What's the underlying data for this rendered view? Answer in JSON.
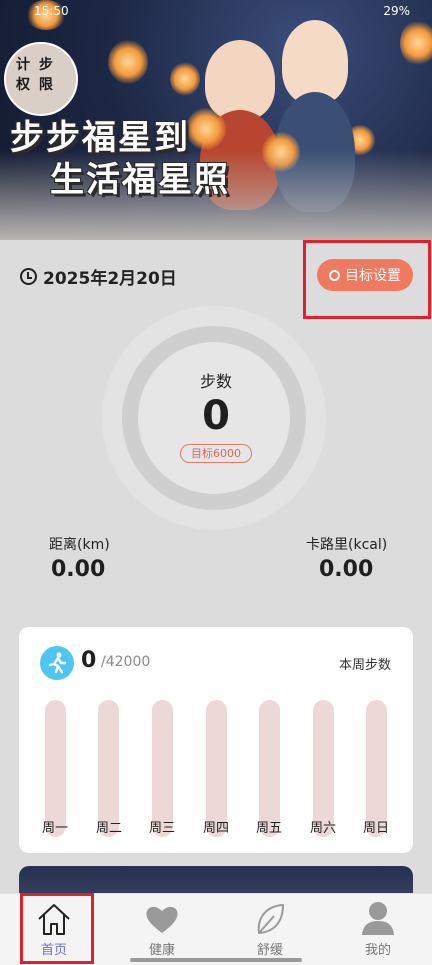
{
  "status_bar": {
    "time": "15:50",
    "battery": "29%"
  },
  "banner": {
    "badge_line1": "计 步",
    "badge_line2": "权 限",
    "slogan_line1": "步步福星到",
    "slogan_line2": "生活福星照"
  },
  "date": "2025年2月20日",
  "goal_button": "目标设置",
  "steps": {
    "label": "步数",
    "value": "0",
    "goal": "目标6000"
  },
  "distance": {
    "label": "距离(km)",
    "value": "0.00"
  },
  "calories": {
    "label": "卡路里(kcal)",
    "value": "0.00"
  },
  "weekly": {
    "total": "0",
    "target": "/42000",
    "title": "本周步数",
    "days": [
      "周一",
      "周二",
      "周三",
      "周四",
      "周五",
      "周六",
      "周日"
    ],
    "values": [
      0,
      0,
      0,
      0,
      0,
      0,
      0
    ]
  },
  "tabs": [
    {
      "label": "首页",
      "icon": "home-icon",
      "active": true
    },
    {
      "label": "健康",
      "icon": "heart-icon",
      "active": false
    },
    {
      "label": "舒缓",
      "icon": "leaf-icon",
      "active": false
    },
    {
      "label": "我的",
      "icon": "user-icon",
      "active": false
    }
  ],
  "colors": {
    "accent": "#f07a5f",
    "highlight": "#e0202a",
    "tab_active": "#6a6fd8",
    "run_icon": "#4fc6f2",
    "bar": "#ecd8d6"
  }
}
